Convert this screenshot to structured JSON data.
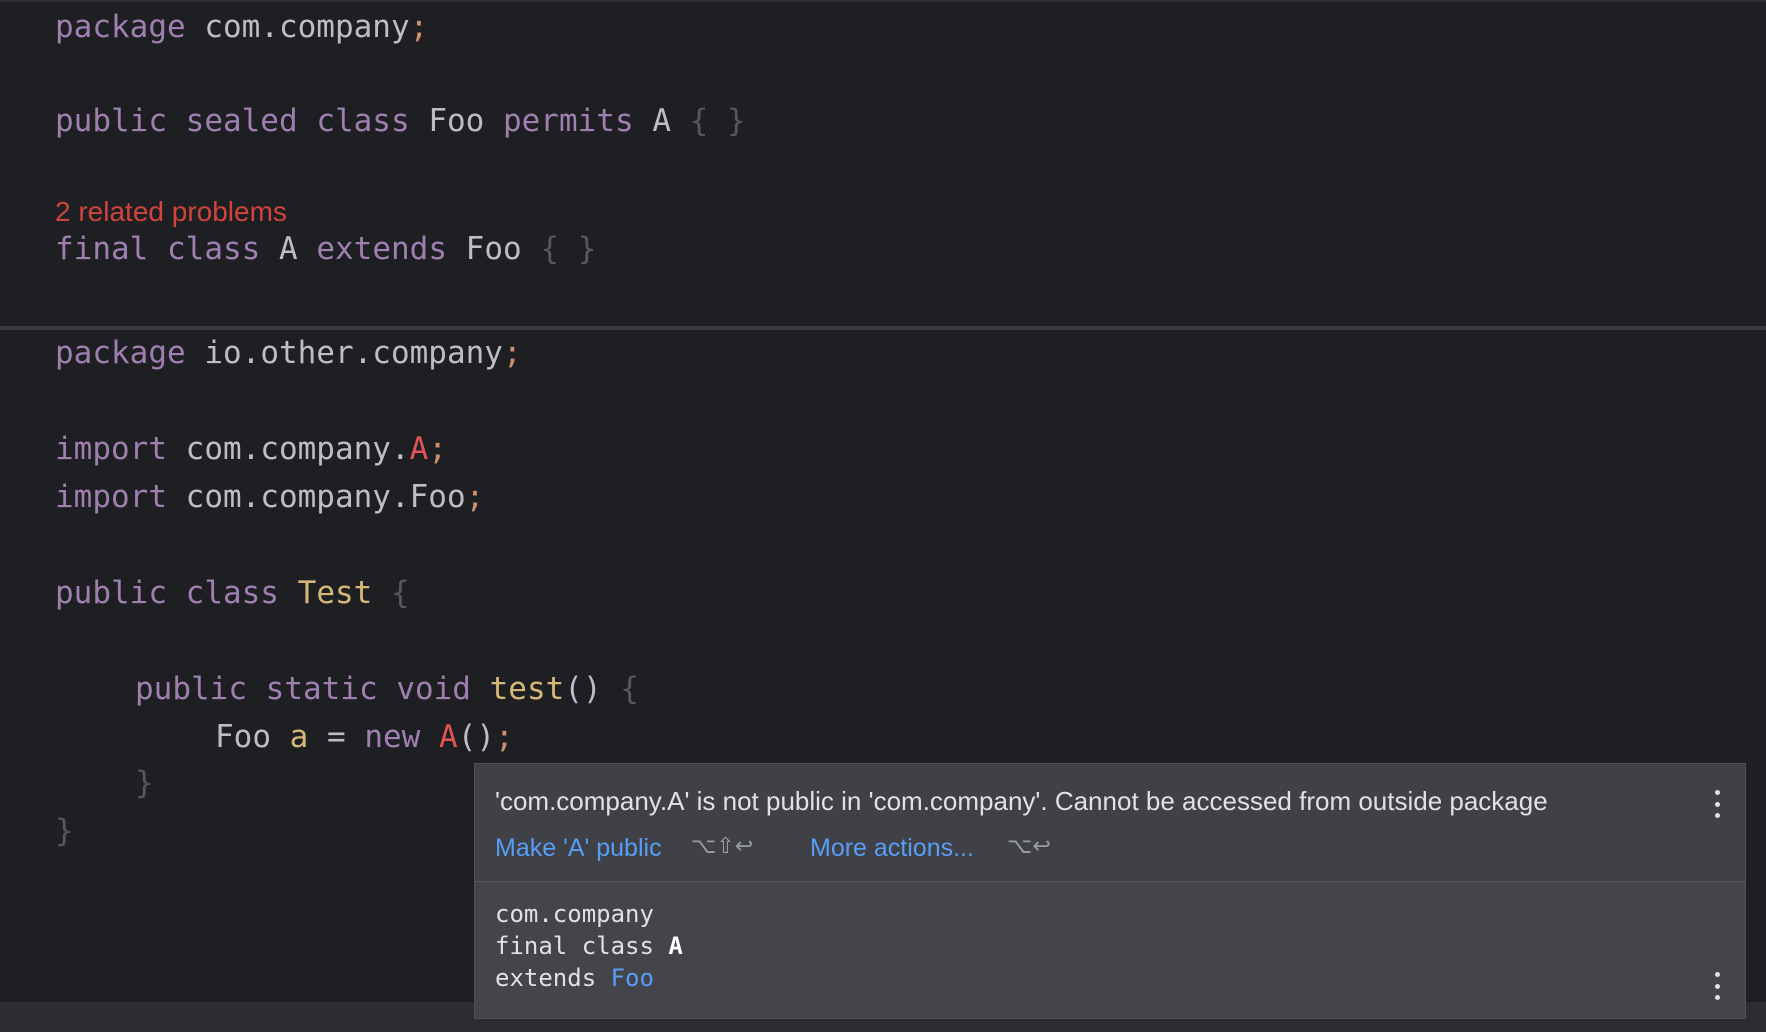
{
  "editor_top": {
    "line1": {
      "kw": "package",
      "name": "com.company",
      "semi": ";"
    },
    "line2": {
      "kw1": "public",
      "kw2": "sealed",
      "kw3": "class",
      "name": "Foo",
      "kw4": "permits",
      "permitted": "A",
      "body": "{ }"
    },
    "problems_label": "2 related problems",
    "line3": {
      "kw1": "final",
      "kw2": "class",
      "name": "A",
      "kw3": "extends",
      "parent": "Foo",
      "body": "{ }"
    }
  },
  "editor_bottom": {
    "line1": {
      "kw": "package",
      "name": "io.other.company",
      "semi": ";"
    },
    "line2": {
      "kw": "import",
      "path": "com.company.",
      "cls": "A",
      "semi": ";"
    },
    "line3": {
      "kw": "import",
      "path": "com.company.Foo",
      "semi": ";"
    },
    "line4": {
      "kw1": "public",
      "kw2": "class",
      "name": "Test",
      "brace": "{"
    },
    "line5": {
      "kw1": "public",
      "kw2": "static",
      "kw3": "void",
      "method": "test",
      "parens": "()",
      "brace": "{"
    },
    "line6": {
      "type": "Foo",
      "var": "a",
      "eq": "=",
      "kw": "new",
      "cls": "A",
      "call": "()",
      "semi": ";"
    },
    "line7": {
      "brace": "}"
    },
    "line8": {
      "brace": "}"
    }
  },
  "popup": {
    "message": "'com.company.A' is not public in 'com.company'. Cannot be accessed from outside package",
    "action_primary": "Make 'A' public",
    "action_primary_shortcut": "⌥⇧↩",
    "action_more": "More actions...",
    "action_more_shortcut": "⌥↩",
    "doc_package": "com.company",
    "doc_decl_prefix": "final class ",
    "doc_decl_name": "A",
    "doc_extends_prefix": "extends ",
    "doc_extends_link": "Foo"
  }
}
